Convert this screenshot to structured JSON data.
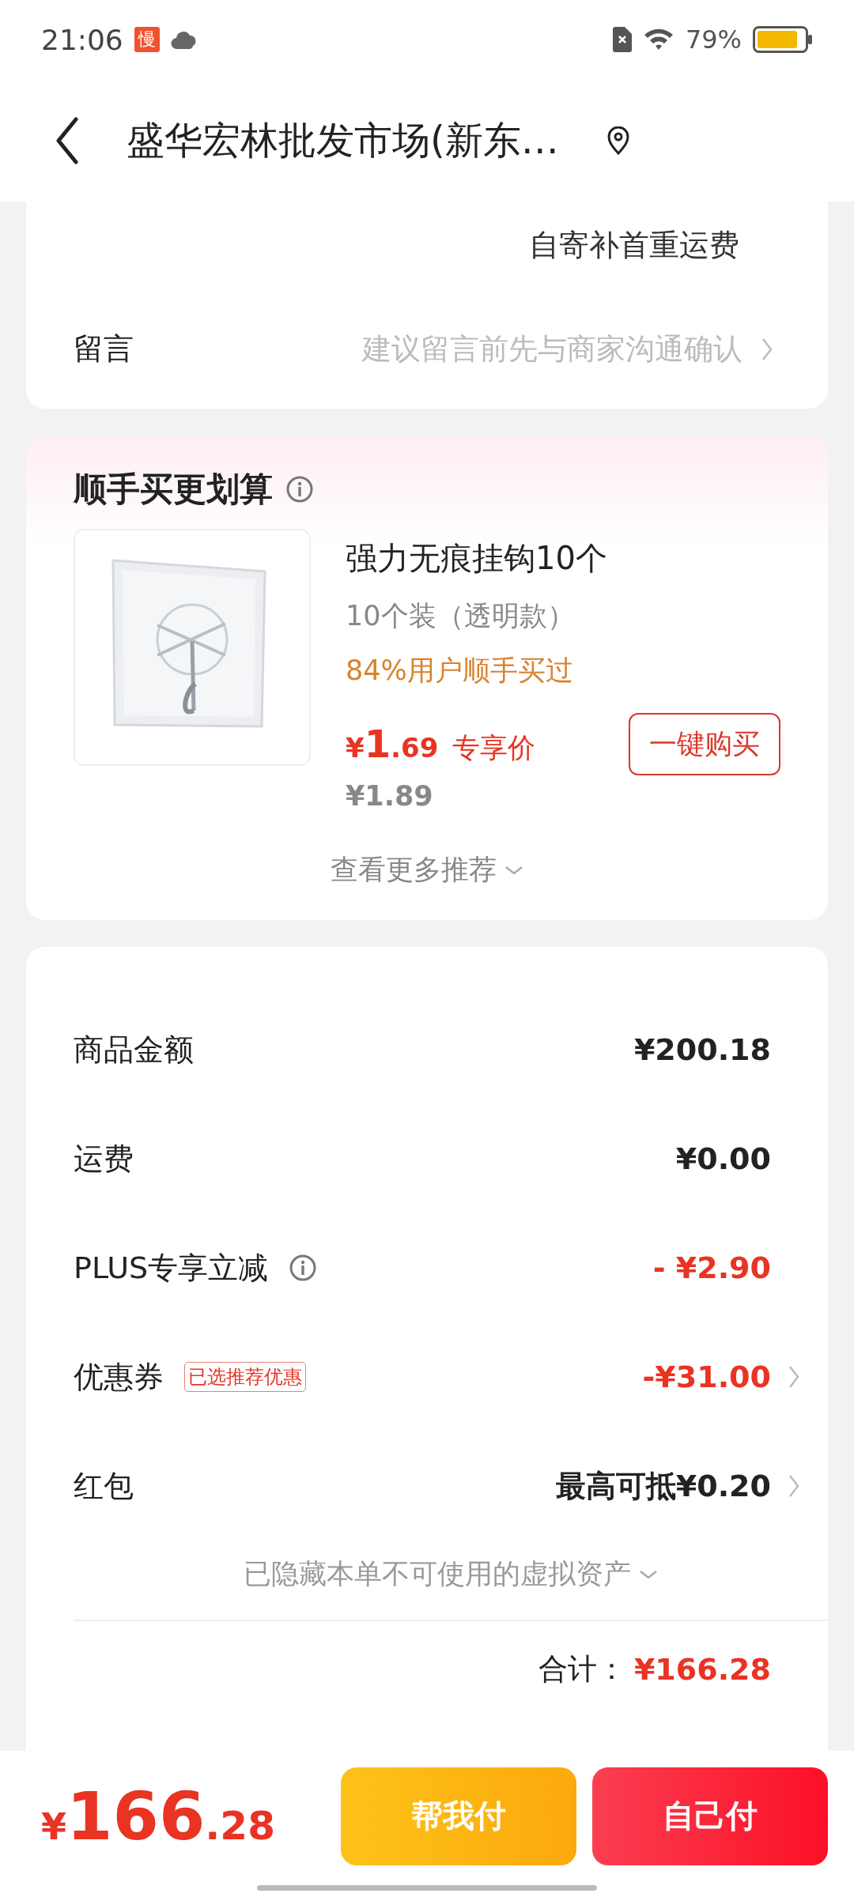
{
  "status_bar": {
    "time": "21:06",
    "app_badge": "慢",
    "battery": "79%"
  },
  "header": {
    "title": "盛华宏林批发市场(新东…"
  },
  "shipping_note": "自寄补首重运费",
  "message_row": {
    "label": "留言",
    "placeholder": "建议留言前先与商家沟通确认"
  },
  "addon": {
    "title": "顺手买更划算",
    "product": {
      "kind": "picture",
      "name": "强力无痕挂钩10个",
      "spec": "10个装（透明款）",
      "note": "84%用户顺手买过",
      "price": "¥1.69",
      "price_tag": "专享价",
      "original_price": "¥1.89",
      "buy_button": "一键购买"
    },
    "more": "查看更多推荐"
  },
  "summary": {
    "rows": [
      {
        "label": "商品金额",
        "value": "¥200.18",
        "red": false,
        "info": false,
        "chevron": false
      },
      {
        "label": "运费",
        "value": "¥0.00",
        "red": false,
        "info": false,
        "chevron": false
      },
      {
        "label": "PLUS专享立减",
        "value": "- ¥2.90",
        "red": true,
        "info": true,
        "chevron": false
      },
      {
        "label": "优惠券",
        "badge": "已选推荐优惠",
        "value": "-¥31.00",
        "red": true,
        "info": false,
        "chevron": true
      },
      {
        "label": "红包",
        "value": "最高可抵¥0.20",
        "red": false,
        "info": false,
        "chevron": true
      }
    ],
    "hidden_assets": "已隐藏本单不可使用的虚拟资产",
    "total_label": "合计：",
    "total": "¥166.28"
  },
  "bottom_bar": {
    "amount": "¥166.28",
    "buttons": [
      {
        "label": "帮我付",
        "kind": "secondary"
      },
      {
        "label": "自己付",
        "kind": "primary"
      }
    ]
  }
}
